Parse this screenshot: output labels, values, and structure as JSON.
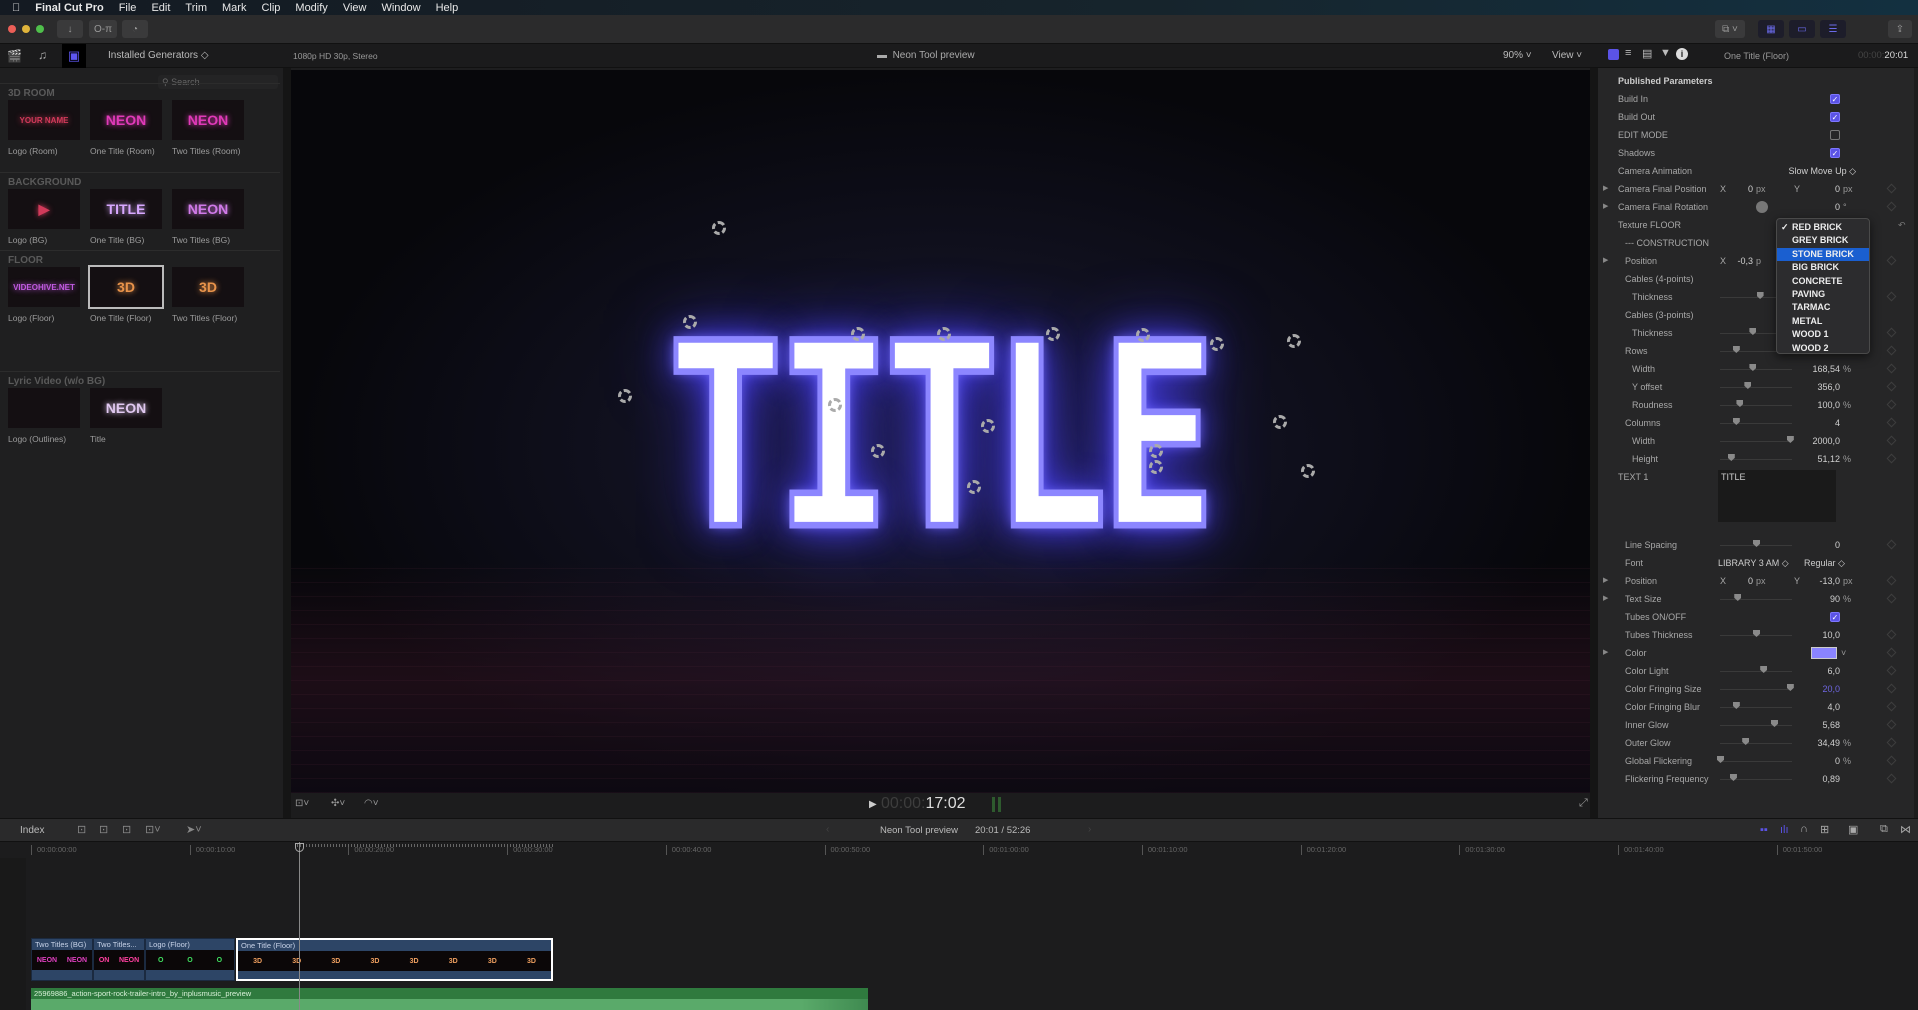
{
  "menubar": {
    "apple": "",
    "app": "Final Cut Pro",
    "items": [
      "File",
      "Edit",
      "Trim",
      "Mark",
      "Clip",
      "Modify",
      "View",
      "Window",
      "Help"
    ]
  },
  "toolbar": {
    "import_icon": "↓",
    "keywords_icon": "O-π",
    "background_tasks_icon": "◔",
    "share_icon": "⇪"
  },
  "browser": {
    "source": "Installed Generators",
    "search_placeholder": "Search",
    "sections": [
      {
        "title": "3D ROOM",
        "items": [
          {
            "label": "Logo (Room)",
            "thumb": "YOUR NAME",
            "color": "#d23a5a"
          },
          {
            "label": "One Title (Room)",
            "thumb": "NEON",
            "color": "#e03ab8"
          },
          {
            "label": "Two Titles (Room)",
            "thumb": "NEON",
            "color": "#e03ab8"
          }
        ]
      },
      {
        "title": "BACKGROUND",
        "items": [
          {
            "label": "Logo (BG)",
            "thumb": "▶",
            "color": "#d23a5a"
          },
          {
            "label": "One Title (BG)",
            "thumb": "TITLE",
            "color": "#d8a8ff"
          },
          {
            "label": "Two Titles (BG)",
            "thumb": "NEON",
            "color": "#d07ae8"
          }
        ]
      },
      {
        "title": "FLOOR",
        "items": [
          {
            "label": "Logo (Floor)",
            "thumb": "VIDEOHIVE.NET",
            "color": "#c05ae0"
          },
          {
            "label": "One Title (Floor)",
            "thumb": "3D",
            "color": "#e8934a",
            "selected": true
          },
          {
            "label": "Two Titles (Floor)",
            "thumb": "3D",
            "color": "#e8934a"
          }
        ]
      },
      {
        "title": "Lyric Video (w/o BG)",
        "items": [
          {
            "label": "Logo (Outlines)",
            "thumb": "",
            "color": "#333"
          },
          {
            "label": "Title",
            "thumb": "NEON",
            "color": "#e0c8f0"
          }
        ]
      }
    ]
  },
  "viewer": {
    "format": "1080p HD 30p, Stereo",
    "title": "Neon Tool preview",
    "zoom": "90%",
    "view_menu": "View",
    "canvas_text": "TITLE",
    "timecode_dim": "00:00:",
    "timecode": "17:02"
  },
  "inspector": {
    "clip_title": "One Title (Floor)",
    "duration_dim": "00:00:",
    "duration": "20:01",
    "section": "Published Parameters",
    "rows": [
      {
        "label": "Build In",
        "type": "checkbox",
        "checked": true
      },
      {
        "label": "Build Out",
        "type": "checkbox",
        "checked": true
      },
      {
        "label": "EDIT MODE",
        "type": "checkbox",
        "checked": false
      },
      {
        "label": "Shadows",
        "type": "checkbox",
        "checked": true
      },
      {
        "label": "Camera Animation",
        "type": "popup",
        "value": "Slow Move Up ◇"
      },
      {
        "label": "Camera Final Position",
        "type": "xy",
        "disclosure": true,
        "x": "0",
        "y": "0",
        "unit": "px"
      },
      {
        "label": "Camera Final Rotation",
        "type": "dial",
        "disclosure": true,
        "value": "0",
        "unit": "°"
      },
      {
        "label": "Texture FLOOR",
        "type": "popup-open"
      },
      {
        "label": "--- CONSTRUCTION",
        "type": "label",
        "indent": 1
      },
      {
        "label": "Position",
        "type": "xy-partial",
        "disclosure": true,
        "indent": 1,
        "x": "-0,3",
        "unit": "p"
      },
      {
        "label": "Cables (4-points)",
        "type": "label",
        "indent": 1
      },
      {
        "label": "Thickness",
        "type": "slider",
        "indent": 2,
        "level": 0.55
      },
      {
        "label": "Cables (3-points)",
        "type": "label",
        "indent": 1
      },
      {
        "label": "Thickness",
        "type": "slider",
        "indent": 2,
        "level": 0.45
      },
      {
        "label": "Rows",
        "type": "slider",
        "indent": 1,
        "level": 0.22
      },
      {
        "label": "Width",
        "type": "slider",
        "indent": 2,
        "level": 0.45,
        "value": "168,54",
        "unit": "%"
      },
      {
        "label": "Y offset",
        "type": "slider",
        "indent": 2,
        "level": 0.38,
        "value": "356,0"
      },
      {
        "label": "Roudness",
        "type": "slider",
        "indent": 2,
        "level": 0.27,
        "value": "100,0",
        "unit": "%"
      },
      {
        "label": "Columns",
        "type": "slider",
        "indent": 1,
        "level": 0.22,
        "value": "4"
      },
      {
        "label": "Width",
        "type": "slider",
        "indent": 2,
        "level": 0.97,
        "value": "2000,0"
      },
      {
        "label": "Height",
        "type": "slider",
        "indent": 2,
        "level": 0.15,
        "value": "51,12",
        "unit": "%"
      },
      {
        "label": "TEXT 1",
        "type": "textarea",
        "value": "TITLE"
      },
      {
        "label": "Line Spacing",
        "type": "slider",
        "indent": 1,
        "level": 0.5,
        "value": "0"
      },
      {
        "label": "Font",
        "type": "font",
        "indent": 1,
        "value": "LIBRARY 3 AM ◇",
        "style": "Regular ◇"
      },
      {
        "label": "Position",
        "type": "xy",
        "disclosure": true,
        "indent": 1,
        "x": "0",
        "y": "-13,0",
        "unit": "px"
      },
      {
        "label": "Text Size",
        "type": "slider",
        "disclosure": true,
        "indent": 1,
        "level": 0.24,
        "value": "90",
        "unit": "%"
      },
      {
        "label": "Tubes ON/OFF",
        "type": "checkbox",
        "indent": 1,
        "checked": true
      },
      {
        "label": "Tubes Thickness",
        "type": "slider",
        "indent": 1,
        "level": 0.5,
        "value": "10,0"
      },
      {
        "label": "Color",
        "type": "color",
        "disclosure": true,
        "indent": 1,
        "color": "#8a84ff"
      },
      {
        "label": "Color Light",
        "type": "slider",
        "indent": 1,
        "level": 0.6,
        "value": "6,0"
      },
      {
        "label": "Color Fringing Size",
        "type": "slider",
        "indent": 1,
        "level": 0.97,
        "value": "20,0",
        "accent": "#6e66e0"
      },
      {
        "label": "Color Fringing Blur",
        "type": "slider",
        "indent": 1,
        "level": 0.22,
        "value": "4,0"
      },
      {
        "label": "Inner Glow",
        "type": "slider",
        "indent": 1,
        "level": 0.75,
        "value": "5,68"
      },
      {
        "label": "Outer Glow",
        "type": "slider",
        "indent": 1,
        "level": 0.35,
        "value": "34,49",
        "unit": "%"
      },
      {
        "label": "Global Flickering",
        "type": "slider",
        "indent": 1,
        "level": 0.0,
        "value": "0",
        "unit": "%"
      },
      {
        "label": "Flickering Frequency",
        "type": "slider",
        "indent": 1,
        "level": 0.18,
        "value": "0,89"
      }
    ],
    "texture_options": [
      "RED BRICK",
      "GREY BRICK",
      "STONE BRICK",
      "BIG BRICK",
      "CONCRETE",
      "PAVING",
      "TARMAC",
      "METAL",
      "WOOD 1",
      "WOOD 2"
    ],
    "texture_selected": "RED BRICK",
    "texture_highlighted": "STONE BRICK"
  },
  "timeline": {
    "index_label": "Index",
    "project": "Neon Tool preview",
    "position": "20:01 / 52:26",
    "ruler": [
      "00:00:00:00",
      "00:00:10:00",
      "00:00:20:00",
      "00:00:30:00",
      "00:00:40:00",
      "00:00:50:00",
      "00:01:00:00",
      "00:01:10:00",
      "00:01:20:00",
      "00:01:30:00",
      "00:01:40:00",
      "00:01:50:00"
    ],
    "clips": [
      {
        "name": "Two Titles (BG)",
        "thumbs": [
          "NEON",
          "NEON"
        ],
        "color": "#e040c0"
      },
      {
        "name": "Two Titles...",
        "thumbs": [
          "ON",
          "NEON"
        ],
        "color": "#ff40a0"
      },
      {
        "name": "Logo (Floor)",
        "thumbs": [
          "O",
          "O",
          "O"
        ],
        "color": "#40e060"
      },
      {
        "name": "One Title (Floor)",
        "thumbs": [
          "3D",
          "3D",
          "3D",
          "3D",
          "3D",
          "3D",
          "3D",
          "3D"
        ],
        "color": "#f0a060",
        "selected": true
      }
    ],
    "audio_clip": "25969886_action-sport-rock-trailer-intro_by_inplusmusic_preview"
  },
  "colors": {
    "accent": "#5b53e6",
    "neon": "#8c86ff",
    "audio": "#3f9a52",
    "clip": "#2d4566"
  }
}
